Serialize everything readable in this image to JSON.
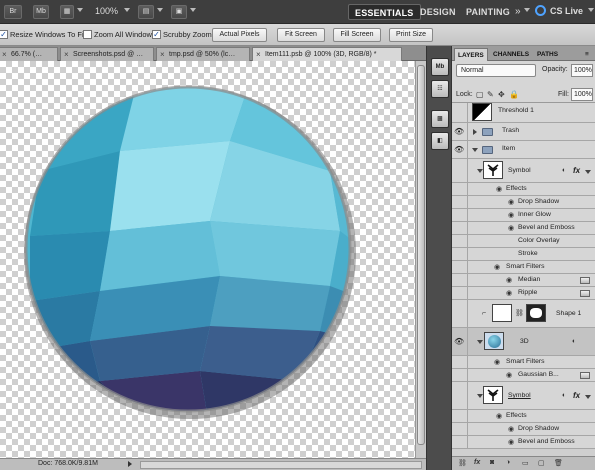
{
  "appbar": {
    "zoom": "100%",
    "workspaces": [
      "ESSENTIALS",
      "DESIGN",
      "PAINTING"
    ],
    "cslive": "CS Live",
    "br_label": "Br",
    "mb_label": "Mb"
  },
  "options": {
    "resize_windows": "Resize Windows To Fit",
    "zoom_all": "Zoom All Windows",
    "scrubby": "Scrubby Zoom",
    "actual_pixels": "Actual Pixels",
    "fit_screen": "Fit Screen",
    "fill_screen": "Fill Screen",
    "print_size": "Print Size"
  },
  "tabs": [
    {
      "label": "66.7% (…"
    },
    {
      "label": "Screenshots.psd @ …"
    },
    {
      "label": "tmp.psd @ 50% (lc…"
    },
    {
      "label": "Item111.psb @ 100% (3D, RGB/8) *"
    }
  ],
  "status": {
    "doc": "Doc: 768.0K/9.81M"
  },
  "panel": {
    "tabs": [
      "LAYERS",
      "CHANNELS",
      "PATHS"
    ],
    "blend_mode": "Normal",
    "opacity_label": "Opacity:",
    "opacity": "100%",
    "lock_label": "Lock:",
    "fill_label": "Fill:",
    "fill": "100%"
  },
  "layers": [
    {
      "name": "Threshold 1"
    },
    {
      "name": "Trash"
    },
    {
      "name": "Item"
    },
    {
      "name": "Symbol"
    },
    {
      "name": "Effects"
    },
    {
      "name": "Drop Shadow"
    },
    {
      "name": "Inner Glow"
    },
    {
      "name": "Bevel and Emboss"
    },
    {
      "name": "Color Overlay"
    },
    {
      "name": "Stroke"
    },
    {
      "name": "Smart Filters"
    },
    {
      "name": "Median"
    },
    {
      "name": "Ripple"
    },
    {
      "name": "Shape 1"
    },
    {
      "name": "3D"
    },
    {
      "name": "Smart Filters"
    },
    {
      "name": "Gaussian B..."
    },
    {
      "name": "Symbol"
    },
    {
      "name": "Effects"
    },
    {
      "name": "Drop Shadow"
    },
    {
      "name": "Bevel and Emboss"
    }
  ],
  "colors": {
    "accent_blue": "#1a4ea0",
    "sphere_light": "#7fd3e6",
    "sphere_dark": "#2b2f5e"
  },
  "icons": [
    "br-icon",
    "mb-icon",
    "zoom-icon",
    "workspace-arrow-icon",
    "eye-icon",
    "folder-icon",
    "fx-icon",
    "lock-icon",
    "link-icon",
    "trash-icon",
    "new-layer-icon"
  ]
}
